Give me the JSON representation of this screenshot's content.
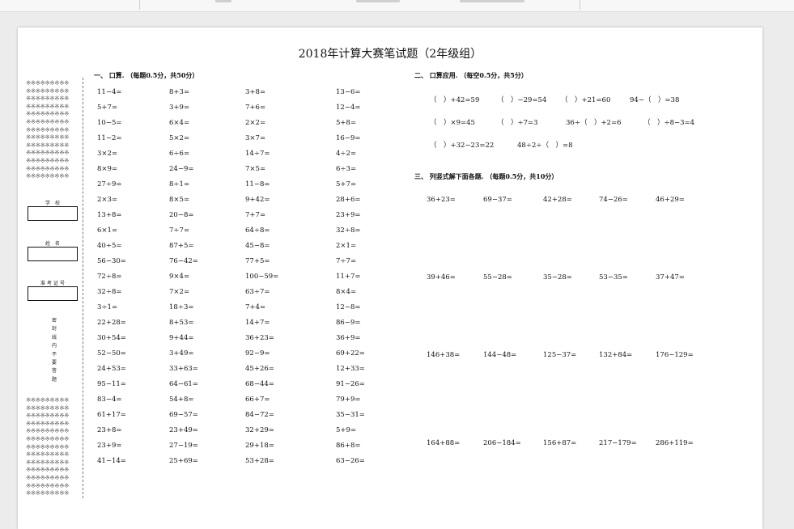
{
  "title": "2018年计算大赛笔试题（2年级组）",
  "binding": {
    "school_label": "学  校",
    "name_label": "姓  名",
    "ticket_label": "准考证号",
    "sealed_text": [
      "密",
      "封",
      "线",
      "内",
      "不",
      "要",
      "答",
      "题"
    ]
  },
  "section1": {
    "title": "一、 口算. （每题0.5分，共50分）",
    "columns": [
      [
        "11−4=",
        "5+7=",
        "10−5=",
        "11−2=",
        "3×2=",
        "8×9=",
        "27÷9=",
        "2×3=",
        "13+8=",
        "6×1=",
        "40÷5=",
        "56−30=",
        "72÷8=",
        "32÷8=",
        "3÷1=",
        "22+28=",
        "30+54=",
        "52−50=",
        "24+53=",
        "95−11=",
        "83−4=",
        "61+17=",
        "23+8=",
        "23+9=",
        "41−14="
      ],
      [
        "8+3=",
        "3+9=",
        "6×4=",
        "5×2=",
        "6÷6=",
        "24−9=",
        "8÷1=",
        "8×5=",
        "20−8=",
        "7÷7=",
        "87+5=",
        "76−42=",
        "9×4=",
        "7×2=",
        "18÷3=",
        "8+53=",
        "9+44=",
        "3+49=",
        "33+63=",
        "64−61=",
        "54+8=",
        "69−57=",
        "23+49=",
        "27−19=",
        "25+69="
      ],
      [
        "3+8=",
        "7+6=",
        "2×2=",
        "3×7=",
        "14÷7=",
        "7×5=",
        "11−8=",
        "9+42=",
        "7+7=",
        "64÷8=",
        "45−8=",
        "77+5=",
        "100−59=",
        "63÷7=",
        "7+4=",
        "14+7=",
        "36+23=",
        "92−9=",
        "45+26=",
        "68−44=",
        "66+7=",
        "84−72=",
        "32+29=",
        "29+18=",
        "53+28="
      ],
      [
        "13−6=",
        "12−4=",
        "5+8=",
        "16−9=",
        "4÷2=",
        "6÷3=",
        "5+7=",
        "28+6=",
        "23+9=",
        "32÷8=",
        "2×1=",
        "7÷7=",
        "11+7=",
        "8×4=",
        "12−8=",
        "86−9=",
        "36+9=",
        "69+22=",
        "12+33=",
        "91−26=",
        "79+9=",
        "35−31=",
        "5+9=",
        "86+8=",
        "63−26="
      ]
    ]
  },
  "section2": {
    "title": "二、 口算应用. （每空0.5分，共5分）",
    "rows": [
      [
        "（　）+42=59",
        "（　）−29=54",
        "（　）+21=60",
        "94−（　）=38"
      ],
      [
        "（　）×9=45",
        "（　）÷7=3",
        "36÷（　）+2=6",
        "（　）÷8−3=4"
      ],
      [
        "（　）+32−23=22",
        "48÷2÷（　）=8"
      ]
    ]
  },
  "section3": {
    "title": "三、 列竖式解下面各题. （每题0.5分，共10分）",
    "rows": [
      [
        "36+23=",
        "69−37=",
        "42+28=",
        "74−26=",
        "46+29="
      ],
      [
        "39+46=",
        "55−28=",
        "35−28=",
        "53−35=",
        "37+47="
      ],
      [
        "146+38=",
        "144−48=",
        "125−37=",
        "132+84=",
        "176−129="
      ],
      [
        "164+88=",
        "206−184=",
        "156+87=",
        "217−179=",
        "286+119="
      ]
    ]
  }
}
